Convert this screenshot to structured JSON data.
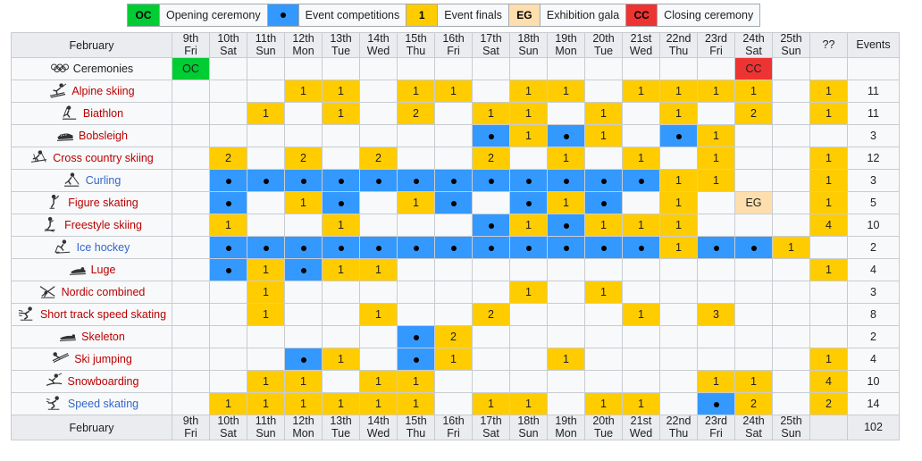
{
  "legend": [
    {
      "key": "OC",
      "label": "Opening ceremony",
      "type": "oc"
    },
    {
      "key": "•",
      "label": "Event competitions",
      "type": "comp"
    },
    {
      "key": "1",
      "label": "Event finals",
      "type": "final"
    },
    {
      "key": "EG",
      "label": "Exhibition gala",
      "type": "gala"
    },
    {
      "key": "CC",
      "label": "Closing ceremony",
      "type": "cc"
    }
  ],
  "colors": {
    "opening": "#00cc33",
    "competition": "#3399ff",
    "final": "#ffcc00",
    "gala": "#ffdead",
    "closing": "#ee3333",
    "header": "#eaecf0",
    "cell": "#f8f9fa",
    "border": "#c8ccd1",
    "link_red": "#ba0000",
    "link_blue": "#3366cc"
  },
  "table": {
    "month_label": "February",
    "events_label": "Events",
    "unknown_label": "??",
    "days": [
      {
        "num": "9th",
        "dow": "Fri"
      },
      {
        "num": "10th",
        "dow": "Sat"
      },
      {
        "num": "11th",
        "dow": "Sun"
      },
      {
        "num": "12th",
        "dow": "Mon"
      },
      {
        "num": "13th",
        "dow": "Tue"
      },
      {
        "num": "14th",
        "dow": "Wed"
      },
      {
        "num": "15th",
        "dow": "Thu"
      },
      {
        "num": "16th",
        "dow": "Fri"
      },
      {
        "num": "17th",
        "dow": "Sat"
      },
      {
        "num": "18th",
        "dow": "Sun"
      },
      {
        "num": "19th",
        "dow": "Mon"
      },
      {
        "num": "20th",
        "dow": "Tue"
      },
      {
        "num": "21st",
        "dow": "Wed"
      },
      {
        "num": "22nd",
        "dow": "Thu"
      },
      {
        "num": "23rd",
        "dow": "Fri"
      },
      {
        "num": "24th",
        "dow": "Sat"
      },
      {
        "num": "25th",
        "dow": "Sun"
      }
    ],
    "total_events": "102",
    "rows": [
      {
        "sport": "Ceremonies",
        "icon": "olympic-rings-icon",
        "link": "dark",
        "cells": [
          "OC",
          "",
          "",
          "",
          "",
          "",
          "",
          "",
          "",
          "",
          "",
          "",
          "",
          "",
          "",
          "CC",
          ""
        ],
        "types": [
          "oc",
          "",
          "",
          "",
          "",
          "",
          "",
          "",
          "",
          "",
          "",
          "",
          "",
          "",
          "",
          "cc",
          ""
        ],
        "unknown": "",
        "unknown_type": "",
        "events": ""
      },
      {
        "sport": "Alpine skiing",
        "icon": "alpine-skiing-icon",
        "link": "red",
        "cells": [
          "",
          "",
          "",
          "1",
          "1",
          "",
          "1",
          "1",
          "",
          "1",
          "1",
          "",
          "1",
          "1",
          "1",
          "1",
          ""
        ],
        "types": [
          "",
          "",
          "",
          "final",
          "final",
          "",
          "final",
          "final",
          "",
          "final",
          "final",
          "",
          "final",
          "final",
          "final",
          "final",
          ""
        ],
        "unknown": "1",
        "unknown_type": "final",
        "events": "11"
      },
      {
        "sport": "Biathlon",
        "icon": "biathlon-icon",
        "link": "red",
        "cells": [
          "",
          "",
          "1",
          "",
          "1",
          "",
          "2",
          "",
          "1",
          "1",
          "",
          "1",
          "",
          "1",
          "",
          "2",
          ""
        ],
        "types": [
          "",
          "",
          "final",
          "",
          "final",
          "",
          "final",
          "",
          "final",
          "final",
          "",
          "final",
          "",
          "final",
          "",
          "final",
          ""
        ],
        "unknown": "1",
        "unknown_type": "final",
        "events": "11"
      },
      {
        "sport": "Bobsleigh",
        "icon": "bobsleigh-icon",
        "link": "red",
        "cells": [
          "",
          "",
          "",
          "",
          "",
          "",
          "",
          "",
          "•",
          "1",
          "•",
          "1",
          "",
          "•",
          "1",
          "",
          ""
        ],
        "types": [
          "",
          "",
          "",
          "",
          "",
          "",
          "",
          "",
          "comp",
          "final",
          "comp",
          "final",
          "",
          "comp",
          "final",
          "",
          ""
        ],
        "unknown": "",
        "unknown_type": "",
        "events": "3"
      },
      {
        "sport": "Cross country skiing",
        "icon": "cross-country-skiing-icon",
        "link": "red",
        "cells": [
          "",
          "2",
          "",
          "2",
          "",
          "2",
          "",
          "",
          "2",
          "",
          "1",
          "",
          "1",
          "",
          "1",
          "",
          ""
        ],
        "types": [
          "",
          "final",
          "",
          "final",
          "",
          "final",
          "",
          "",
          "final",
          "",
          "final",
          "",
          "final",
          "",
          "final",
          "",
          ""
        ],
        "unknown": "1",
        "unknown_type": "final",
        "events": "12"
      },
      {
        "sport": "Curling",
        "icon": "curling-icon",
        "link": "blue",
        "cells": [
          "",
          "•",
          "•",
          "•",
          "•",
          "•",
          "•",
          "•",
          "•",
          "•",
          "•",
          "•",
          "•",
          "1",
          "1",
          "",
          ""
        ],
        "types": [
          "",
          "comp",
          "comp",
          "comp",
          "comp",
          "comp",
          "comp",
          "comp",
          "comp",
          "comp",
          "comp",
          "comp",
          "comp",
          "final",
          "final",
          "",
          ""
        ],
        "unknown": "1",
        "unknown_type": "final",
        "events": "3"
      },
      {
        "sport": "Figure skating",
        "icon": "figure-skating-icon",
        "link": "red",
        "cells": [
          "",
          "•",
          "",
          "1",
          "•",
          "",
          "1",
          "•",
          "",
          "•",
          "1",
          "•",
          "",
          "1",
          "",
          "EG",
          ""
        ],
        "types": [
          "",
          "comp",
          "",
          "final",
          "comp",
          "",
          "final",
          "comp",
          "",
          "comp",
          "final",
          "comp",
          "",
          "final",
          "",
          "gala",
          ""
        ],
        "unknown": "1",
        "unknown_type": "final",
        "events": "5"
      },
      {
        "sport": "Freestyle skiing",
        "icon": "freestyle-skiing-icon",
        "link": "red",
        "cells": [
          "",
          "1",
          "",
          "",
          "1",
          "",
          "",
          "",
          "•",
          "1",
          "•",
          "1",
          "1",
          "1",
          "",
          "",
          ""
        ],
        "types": [
          "",
          "final",
          "",
          "",
          "final",
          "",
          "",
          "",
          "comp",
          "final",
          "comp",
          "final",
          "final",
          "final",
          "",
          "",
          ""
        ],
        "unknown": "4",
        "unknown_type": "final",
        "events": "10"
      },
      {
        "sport": "Ice hockey",
        "icon": "ice-hockey-icon",
        "link": "blue",
        "cells": [
          "",
          "•",
          "•",
          "•",
          "•",
          "•",
          "•",
          "•",
          "•",
          "•",
          "•",
          "•",
          "•",
          "1",
          "•",
          "•",
          "1"
        ],
        "types": [
          "",
          "comp",
          "comp",
          "comp",
          "comp",
          "comp",
          "comp",
          "comp",
          "comp",
          "comp",
          "comp",
          "comp",
          "comp",
          "final",
          "comp",
          "comp",
          "final"
        ],
        "unknown": "",
        "unknown_type": "",
        "events": "2"
      },
      {
        "sport": "Luge",
        "icon": "luge-icon",
        "link": "red",
        "cells": [
          "",
          "•",
          "1",
          "•",
          "1",
          "1",
          "",
          "",
          "",
          "",
          "",
          "",
          "",
          "",
          "",
          "",
          ""
        ],
        "types": [
          "",
          "comp",
          "final",
          "comp",
          "final",
          "final",
          "",
          "",
          "",
          "",
          "",
          "",
          "",
          "",
          "",
          "",
          ""
        ],
        "unknown": "1",
        "unknown_type": "final",
        "events": "4"
      },
      {
        "sport": "Nordic combined",
        "icon": "nordic-combined-icon",
        "link": "red",
        "cells": [
          "",
          "",
          "1",
          "",
          "",
          "",
          "",
          "",
          "",
          "1",
          "",
          "1",
          "",
          "",
          "",
          "",
          ""
        ],
        "types": [
          "",
          "",
          "final",
          "",
          "",
          "",
          "",
          "",
          "",
          "final",
          "",
          "final",
          "",
          "",
          "",
          "",
          ""
        ],
        "unknown": "",
        "unknown_type": "",
        "events": "3"
      },
      {
        "sport": "Short track speed skating",
        "icon": "short-track-speed-skating-icon",
        "link": "red",
        "cells": [
          "",
          "",
          "1",
          "",
          "",
          "1",
          "",
          "",
          "2",
          "",
          "",
          "",
          "1",
          "",
          "3",
          "",
          ""
        ],
        "types": [
          "",
          "",
          "final",
          "",
          "",
          "final",
          "",
          "",
          "final",
          "",
          "",
          "",
          "final",
          "",
          "final",
          "",
          ""
        ],
        "unknown": "",
        "unknown_type": "",
        "events": "8"
      },
      {
        "sport": "Skeleton",
        "icon": "skeleton-icon",
        "link": "red",
        "cells": [
          "",
          "",
          "",
          "",
          "",
          "",
          "•",
          "2",
          "",
          "",
          "",
          "",
          "",
          "",
          "",
          "",
          ""
        ],
        "types": [
          "",
          "",
          "",
          "",
          "",
          "",
          "comp",
          "final",
          "",
          "",
          "",
          "",
          "",
          "",
          "",
          "",
          ""
        ],
        "unknown": "",
        "unknown_type": "",
        "events": "2"
      },
      {
        "sport": "Ski jumping",
        "icon": "ski-jumping-icon",
        "link": "red",
        "cells": [
          "",
          "",
          "",
          "•",
          "1",
          "",
          "•",
          "1",
          "",
          "",
          "1",
          "",
          "",
          "",
          "",
          "",
          ""
        ],
        "types": [
          "",
          "",
          "",
          "comp",
          "final",
          "",
          "comp",
          "final",
          "",
          "",
          "final",
          "",
          "",
          "",
          "",
          "",
          ""
        ],
        "unknown": "1",
        "unknown_type": "final",
        "events": "4"
      },
      {
        "sport": "Snowboarding",
        "icon": "snowboarding-icon",
        "link": "red",
        "cells": [
          "",
          "",
          "1",
          "1",
          "",
          "1",
          "1",
          "",
          "",
          "",
          "",
          "",
          "",
          "",
          "1",
          "1",
          ""
        ],
        "types": [
          "",
          "",
          "final",
          "final",
          "",
          "final",
          "final",
          "",
          "",
          "",
          "",
          "",
          "",
          "",
          "final",
          "final",
          ""
        ],
        "unknown": "4",
        "unknown_type": "final",
        "events": "10"
      },
      {
        "sport": "Speed skating",
        "icon": "speed-skating-icon",
        "link": "blue",
        "cells": [
          "",
          "1",
          "1",
          "1",
          "1",
          "1",
          "1",
          "",
          "1",
          "1",
          "",
          "1",
          "1",
          "",
          "•",
          "2",
          ""
        ],
        "types": [
          "",
          "final",
          "final",
          "final",
          "final",
          "final",
          "final",
          "",
          "final",
          "final",
          "",
          "final",
          "final",
          "",
          "comp",
          "final",
          ""
        ],
        "unknown": "2",
        "unknown_type": "final",
        "events": "14"
      }
    ]
  }
}
